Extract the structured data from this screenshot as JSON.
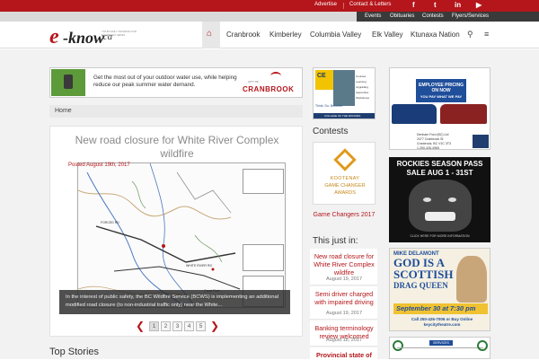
{
  "topbar": {
    "links": [
      "Advertise",
      "Contact & Letters"
    ],
    "social": [
      "f",
      "t",
      "in",
      "▶"
    ]
  },
  "secondary_nav": [
    "Events",
    "Obituaries",
    "Contests",
    "Flyers/Services"
  ],
  "header": {
    "logo_e": "e",
    "logo_know": "-know",
    "logo_ca": ".ca",
    "logo_tagline": "YOUR DAILY SOURCE FOR KOOTENAY NEWS",
    "nav": [
      "Cranbrook",
      "Kimberley",
      "Columbia Valley",
      "Elk Valley",
      "Ktunaxa Nation"
    ]
  },
  "banner_ad": {
    "text": "Get the most out of your outdoor water use, while helping reduce our peak summer water demand.",
    "city_sub": "CITY OF",
    "city": "CRANBROOK"
  },
  "breadcrumb": "Home",
  "article": {
    "title": "New road closure for White River Complex wildfire",
    "date": "Posted August 19th, 2017",
    "caption": "In the interest of public safety, the BC Wildfire Service (BCWS) is implementing an additional modified road closure (to non-industrial traffic only) near the White...",
    "map_labels": [
      "FORCED RD",
      "WHITE RIVER RD",
      "Canal Flats",
      "ALBERTA"
    ],
    "pages": [
      "1",
      "2",
      "3",
      "4",
      "5"
    ],
    "current_page": "1"
  },
  "top_stories": "Top Stories",
  "ce_ad": {
    "logo": "CE",
    "list": [
      "Courses",
      "Learning",
      "Upgrading",
      "Apprentice",
      "Workshops"
    ],
    "tagline": "Think. Do. Become.",
    "college": "COLLEGE OF THE ROCKIES"
  },
  "contests": {
    "heading": "Contests",
    "card_line1": "KOOTENAY",
    "card_line2": "GAME CHANGER",
    "card_line3": "AWARDS",
    "link": "Game Changers 2017"
  },
  "just_in": {
    "heading": "This just in:",
    "items": [
      {
        "title": "New road closure for White River Complex wildfire",
        "date": "August 19, 2017"
      },
      {
        "title": "Semi driver charged with impaired driving",
        "date": "August 19, 2017"
      },
      {
        "title": "Banking terminology review welcomed",
        "date": "August 18, 2017"
      },
      {
        "title": "Provincial state of",
        "date": ""
      }
    ]
  },
  "ads": {
    "employee_pricing": "EMPLOYEE PRICING ON NOW",
    "employee_sub": "YOU PAY WHAT WE PAY",
    "dealer_address": [
      "Denham Ford (BC) Ltd",
      "2477 Cranbrook St",
      "Cranbrook, BC V1C 3T3",
      "1-250-426-4965"
    ],
    "rockies_line1": "ROCKIES SEASON PASS",
    "rockies_line2": "SALE AUG 1 - 31ST",
    "rockies_footer": "CLICK HERE FOR MORE INFORMATION",
    "show_name": "MIKE DELAMONT",
    "show_line1": "GOD IS A",
    "show_line2": "SCOTTISH",
    "show_line3": "DRAG QUEEN",
    "show_date": "September 30 at 7:30 pm",
    "show_info": "Call 250-426-7006 or Buy Online keycitytheatre.com",
    "services_header": "SERVICES"
  }
}
